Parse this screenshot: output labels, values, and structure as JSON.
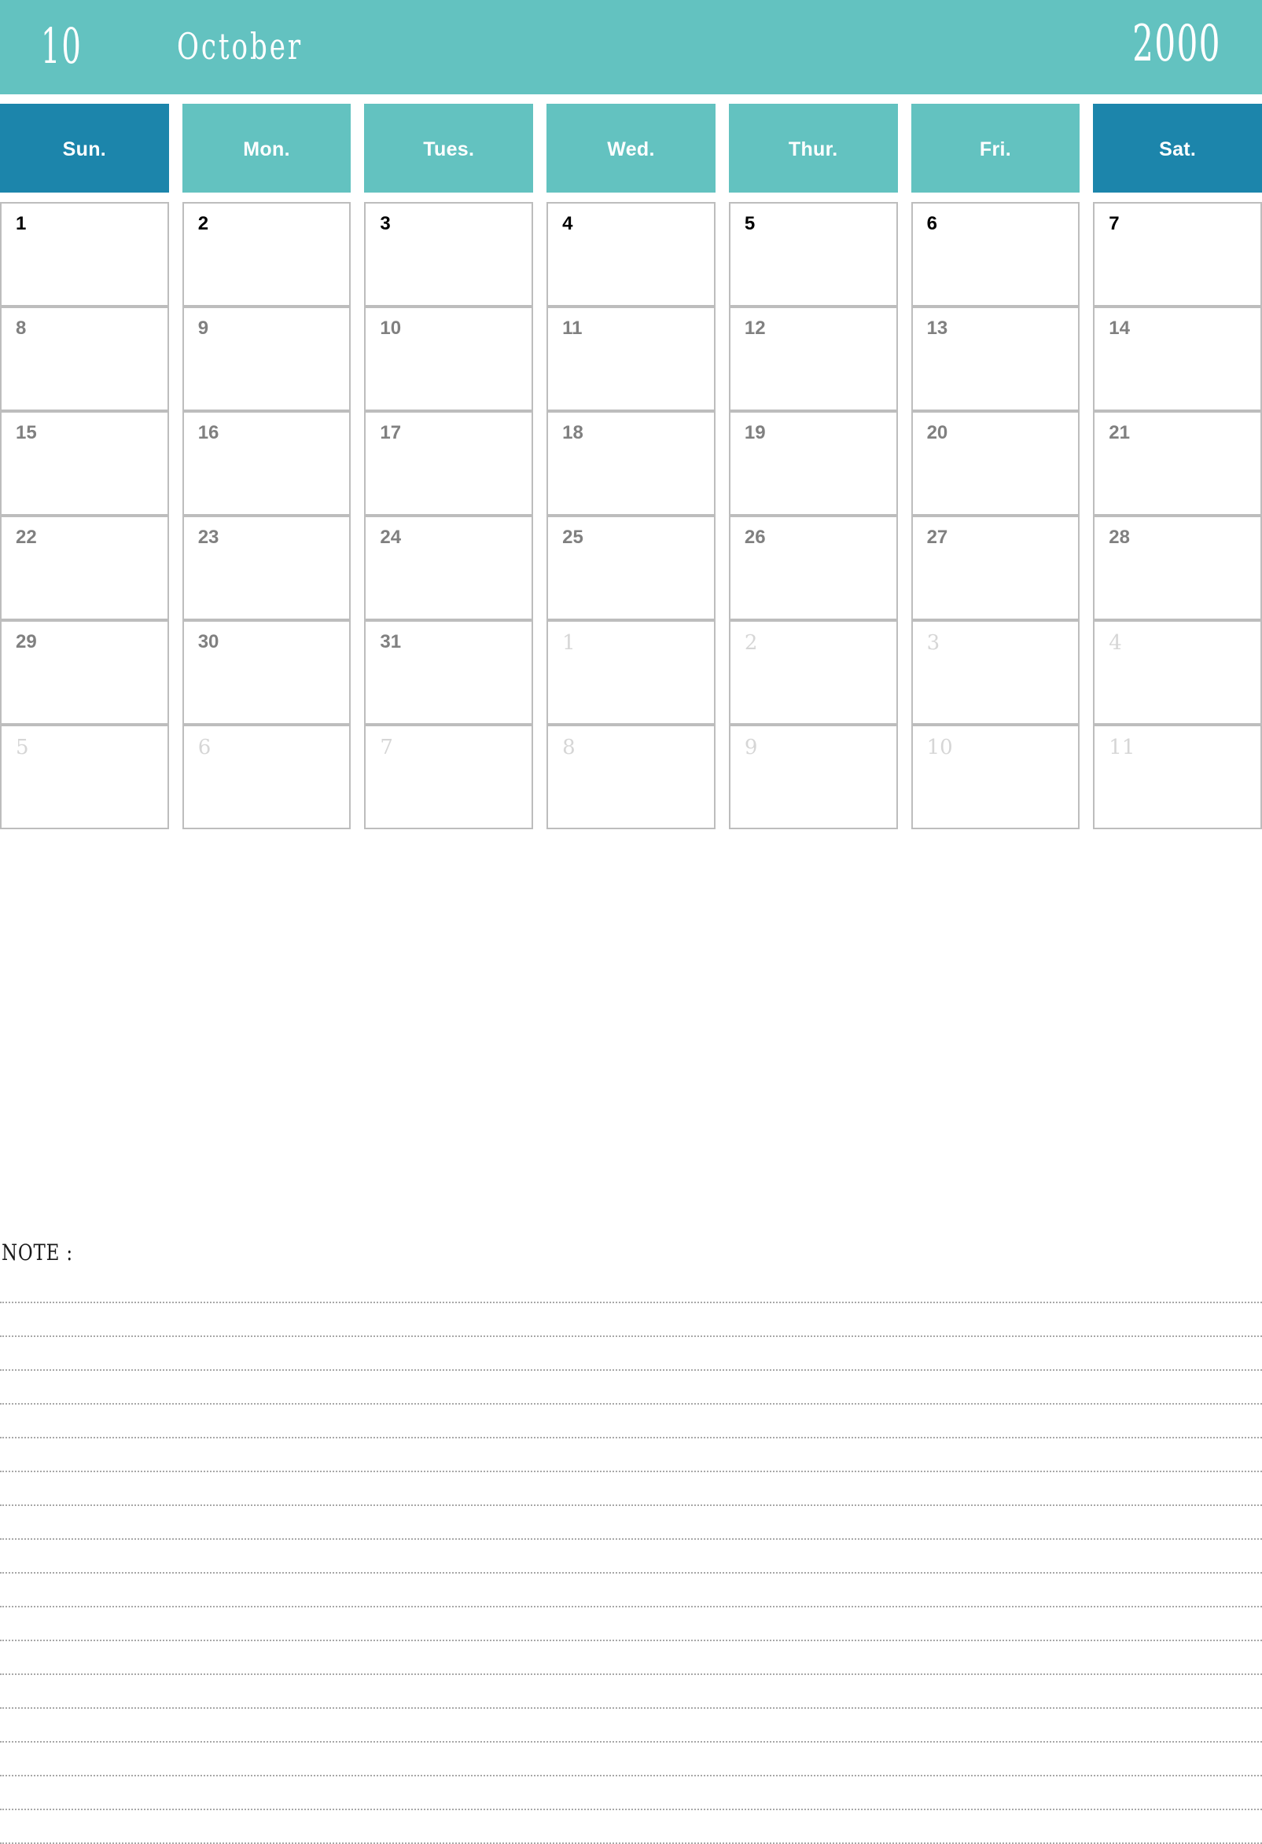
{
  "header": {
    "month_number": "10",
    "month_name": "October",
    "year": "2000",
    "band_color": "#63c2c0",
    "text_color": "#ffffff"
  },
  "weekdays": [
    {
      "label": "Sun.",
      "weekend": true,
      "color": "#1c85ab"
    },
    {
      "label": "Mon.",
      "weekend": false,
      "color": "#63c2c0"
    },
    {
      "label": "Tues.",
      "weekend": false,
      "color": "#63c2c0"
    },
    {
      "label": "Wed.",
      "weekend": false,
      "color": "#63c2c0"
    },
    {
      "label": "Thur.",
      "weekend": false,
      "color": "#63c2c0"
    },
    {
      "label": "Fri.",
      "weekend": false,
      "color": "#63c2c0"
    },
    {
      "label": "Sat.",
      "weekend": true,
      "color": "#1c85ab"
    }
  ],
  "calendar": {
    "weeks": [
      [
        {
          "day": "1",
          "current_month": true
        },
        {
          "day": "2",
          "current_month": true
        },
        {
          "day": "3",
          "current_month": true
        },
        {
          "day": "4",
          "current_month": true
        },
        {
          "day": "5",
          "current_month": true
        },
        {
          "day": "6",
          "current_month": true
        },
        {
          "day": "7",
          "current_month": true
        }
      ],
      [
        {
          "day": "8",
          "current_month": true
        },
        {
          "day": "9",
          "current_month": true
        },
        {
          "day": "10",
          "current_month": true
        },
        {
          "day": "11",
          "current_month": true
        },
        {
          "day": "12",
          "current_month": true
        },
        {
          "day": "13",
          "current_month": true
        },
        {
          "day": "14",
          "current_month": true
        }
      ],
      [
        {
          "day": "15",
          "current_month": true
        },
        {
          "day": "16",
          "current_month": true
        },
        {
          "day": "17",
          "current_month": true
        },
        {
          "day": "18",
          "current_month": true
        },
        {
          "day": "19",
          "current_month": true
        },
        {
          "day": "20",
          "current_month": true
        },
        {
          "day": "21",
          "current_month": true
        }
      ],
      [
        {
          "day": "22",
          "current_month": true
        },
        {
          "day": "23",
          "current_month": true
        },
        {
          "day": "24",
          "current_month": true
        },
        {
          "day": "25",
          "current_month": true
        },
        {
          "day": "26",
          "current_month": true
        },
        {
          "day": "27",
          "current_month": true
        },
        {
          "day": "28",
          "current_month": true
        }
      ],
      [
        {
          "day": "29",
          "current_month": true
        },
        {
          "day": "30",
          "current_month": true
        },
        {
          "day": "31",
          "current_month": true
        },
        {
          "day": "1",
          "current_month": false
        },
        {
          "day": "2",
          "current_month": false
        },
        {
          "day": "3",
          "current_month": false
        },
        {
          "day": "4",
          "current_month": false
        }
      ],
      [
        {
          "day": "5",
          "current_month": false
        },
        {
          "day": "6",
          "current_month": false
        },
        {
          "day": "7",
          "current_month": false
        },
        {
          "day": "8",
          "current_month": false
        },
        {
          "day": "9",
          "current_month": false
        },
        {
          "day": "10",
          "current_month": false
        },
        {
          "day": "11",
          "current_month": false
        }
      ]
    ]
  },
  "note": {
    "label": "NOTE :",
    "line_count": 17
  },
  "colors": {
    "teal": "#63c2c0",
    "blue": "#1c85ab",
    "cell_border": "#bdbdbd",
    "day_text": "#808080",
    "day_text_first_week": "#000000",
    "other_month_text": "#d6d6d6",
    "note_line": "#a8a8a8"
  }
}
